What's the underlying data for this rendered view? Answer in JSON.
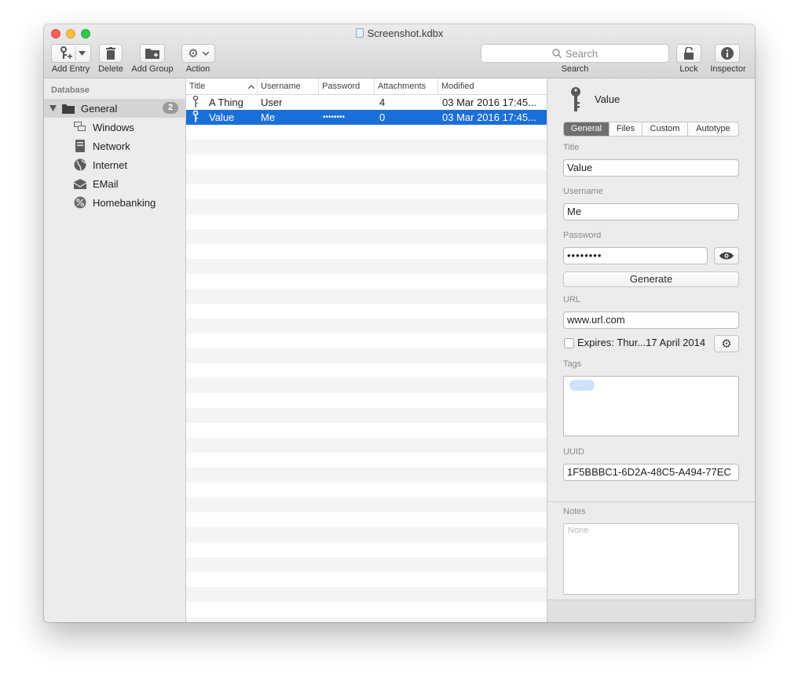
{
  "window": {
    "title": "Screenshot.kdbx"
  },
  "toolbar": {
    "add_entry": "Add Entry",
    "delete": "Delete",
    "add_group": "Add Group",
    "action": "Action",
    "search_placeholder": "Search",
    "search_label": "Search",
    "lock": "Lock",
    "inspector": "Inspector"
  },
  "sidebar": {
    "header": "Database",
    "group": {
      "label": "General",
      "count": "2"
    },
    "items": [
      {
        "label": "Windows",
        "icon": "windows-icon"
      },
      {
        "label": "Network",
        "icon": "network-icon"
      },
      {
        "label": "Internet",
        "icon": "globe-icon"
      },
      {
        "label": "EMail",
        "icon": "email-icon"
      },
      {
        "label": "Homebanking",
        "icon": "percent-icon"
      }
    ]
  },
  "list": {
    "columns": [
      "Title",
      "Username",
      "Password",
      "Attachments",
      "Modified"
    ],
    "rows": [
      {
        "title": "A Thing",
        "username": "User",
        "password": "",
        "attachments": "4",
        "modified": "03 Mar 2016 17:45..."
      },
      {
        "title": "Value",
        "username": "Me",
        "password": "••••••••",
        "attachments": "0",
        "modified": "03 Mar 2016 17:45..."
      }
    ]
  },
  "inspector": {
    "title": "Value",
    "tabs": [
      "General",
      "Files",
      "Custom",
      "Autotype"
    ],
    "title_label": "Title",
    "title_value": "Value",
    "username_label": "Username",
    "username_value": "Me",
    "password_label": "Password",
    "password_value": "••••••••",
    "generate_label": "Generate",
    "url_label": "URL",
    "url_value": "www.url.com",
    "expires_label": "Expires: Thur...17 April 2014",
    "tags_label": "Tags",
    "uuid_label": "UUID",
    "uuid_value": "1F5BBBC1-6D2A-48C5-A494-77EC",
    "notes_label": "Notes",
    "notes_placeholder": "None"
  },
  "colors": {
    "selection": "#1b6fd8",
    "tag": "#cfe2fa"
  }
}
